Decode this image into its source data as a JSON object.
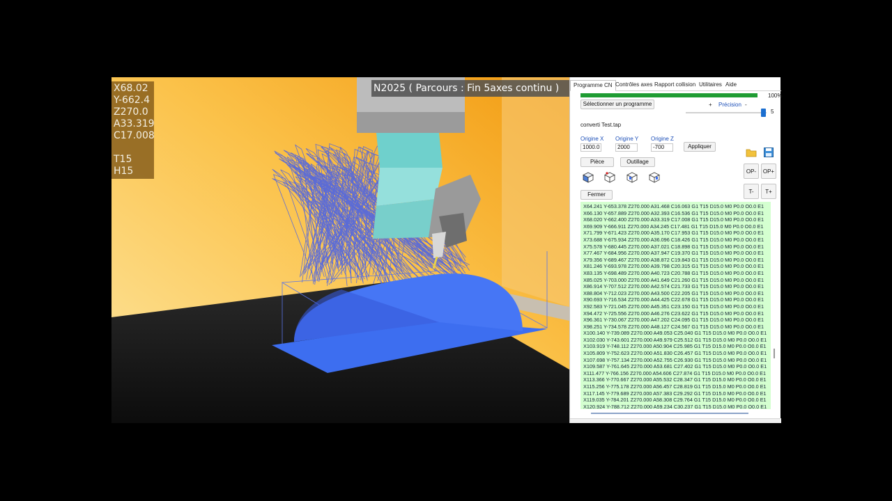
{
  "viewport": {
    "coords": {
      "x": "X68.02",
      "y": "Y-662.4",
      "z": "Z270.0",
      "a": "A33.319",
      "c": "C17.008",
      "t": "T15",
      "h": "H15"
    },
    "block_text": "N2025 ( Parcours : Fin 5axes continu )"
  },
  "panel": {
    "tabs": [
      "Programme CN",
      "Contrôles axes",
      "Rapport collision",
      "Utilitaires",
      "Aide"
    ],
    "progress_percent": 100,
    "progress_label": "100%",
    "select_program_label": "Sélectionner un programme",
    "precision_plus": "+",
    "precision_label": "Précision",
    "precision_minus": "-",
    "precision_value": "5",
    "program_name": "converti Test.tap",
    "origin_x_label": "Origine X",
    "origin_y_label": "Origine Y",
    "origin_z_label": "Origine Z",
    "origin_x_value": "1000.0",
    "origin_y_value": "2000",
    "origin_z_value": "-700",
    "apply_label": "Appliquer",
    "piece_label": "Pièce",
    "tooling_label": "Outillage",
    "close_label": "Fermer",
    "op_minus": "OP-",
    "op_plus": "OP+",
    "t_minus": "T-",
    "t_plus": "T+",
    "code_lines": [
      "X64.241 Y-653.378 Z270.000 A31.468 C16.063 G1 T15 D15.0 M0 P0.0 O0.0 E1",
      "X66.130 Y-657.889 Z270.000 A32.393 C16.536 G1 T15 D15.0 M0 P0.0 O0.0 E1",
      "X68.020 Y-662.400 Z270.000 A33.319 C17.008 G1 T15 D15.0 M0 P0.0 O0.0 E1",
      "X69.909 Y-666.911 Z270.000 A34.245 C17.481 G1 T15 D15.0 M0 P0.0 O0.0 E1",
      "X71.799 Y-671.423 Z270.000 A35.170 C17.953 G1 T15 D15.0 M0 P0.0 O0.0 E1",
      "X73.688 Y-675.934 Z270.000 A36.096 C18.426 G1 T15 D15.0 M0 P0.0 O0.0 E1",
      "X75.578 Y-680.445 Z270.000 A37.021 C18.898 G1 T15 D15.0 M0 P0.0 O0.0 E1",
      "X77.467 Y-684.956 Z270.000 A37.947 C19.370 G1 T15 D15.0 M0 P0.0 O0.0 E1",
      "X79.356 Y-689.467 Z270.000 A38.872 C19.843 G1 T15 D15.0 M0 P0.0 O0.0 E1",
      "X81.246 Y-693.978 Z270.000 A39.798 C20.315 G1 T15 D15.0 M0 P0.0 O0.0 E1",
      "X83.135 Y-698.489 Z270.000 A40.723 C20.788 G1 T15 D15.0 M0 P0.0 O0.0 E1",
      "X85.025 Y-703.000 Z270.000 A41.649 C21.260 G1 T15 D15.0 M0 P0.0 O0.0 E1",
      "X86.914 Y-707.512 Z270.000 A42.574 C21.733 G1 T15 D15.0 M0 P0.0 O0.0 E1",
      "X88.804 Y-712.023 Z270.000 A43.500 C22.205 G1 T15 D15.0 M0 P0.0 O0.0 E1",
      "X90.693 Y-716.534 Z270.000 A44.425 C22.678 G1 T15 D15.0 M0 P0.0 O0.0 E1",
      "X92.583 Y-721.045 Z270.000 A45.351 C23.150 G1 T15 D15.0 M0 P0.0 O0.0 E1",
      "X94.472 Y-725.556 Z270.000 A46.276 C23.622 G1 T15 D15.0 M0 P0.0 O0.0 E1",
      "X96.361 Y-730.067 Z270.000 A47.202 C24.095 G1 T15 D15.0 M0 P0.0 O0.0 E1",
      "X98.251 Y-734.578 Z270.000 A48.127 C24.567 G1 T15 D15.0 M0 P0.0 O0.0 E1",
      "X100.140 Y-739.089 Z270.000 A49.053 C25.040 G1 T15 D15.0 M0 P0.0 O0.0 E1",
      "X102.030 Y-743.601 Z270.000 A49.979 C25.512 G1 T15 D15.0 M0 P0.0 O0.0 E1",
      "X103.919 Y-748.112 Z270.000 A50.904 C25.985 G1 T15 D15.0 M0 P0.0 O0.0 E1",
      "X105.809 Y-752.623 Z270.000 A51.830 C26.457 G1 T15 D15.0 M0 P0.0 O0.0 E1",
      "X107.698 Y-757.134 Z270.000 A52.755 C26.930 G1 T15 D15.0 M0 P0.0 O0.0 E1",
      "X109.587 Y-761.645 Z270.000 A53.681 C27.402 G1 T15 D15.0 M0 P0.0 O0.0 E1",
      "X111.477 Y-766.156 Z270.000 A54.606 C27.874 G1 T15 D15.0 M0 P0.0 O0.0 E1",
      "X113.366 Y-770.667 Z270.000 A55.532 C28.347 G1 T15 D15.0 M0 P0.0 O0.0 E1",
      "X115.256 Y-775.178 Z270.000 A56.457 C28.819 G1 T15 D15.0 M0 P0.0 O0.0 E1",
      "X117.145 Y-779.689 Z270.000 A57.383 C29.292 G1 T15 D15.0 M0 P0.0 O0.0 E1",
      "X119.035 Y-784.201 Z270.000 A58.308 C29.764 G1 T15 D15.0 M0 P0.0 O0.0 E1",
      "X120.924 Y-788.712 Z270.000 A59.234 C30.237 G1 T15 D15.0 M0 P0.0 O0.0 E1"
    ]
  },
  "colors": {
    "wall_light": "#fde6a0",
    "wall_dark": "#f5a81a",
    "floor": "#151515",
    "part_blue": "#3d6ef0",
    "toolpath_blue": "#4b63e6",
    "head_teal": "#8ad8d4",
    "head_gray": "#a8a8a8",
    "code_bg": "#d4ffd0",
    "progress": "#1f9c33",
    "label_blue": "#1c4fb8"
  },
  "icons": [
    "folder-icon",
    "save-icon",
    "view-cube-icon-1",
    "view-cube-icon-2",
    "view-cube-icon-3",
    "view-cube-icon-4"
  ]
}
